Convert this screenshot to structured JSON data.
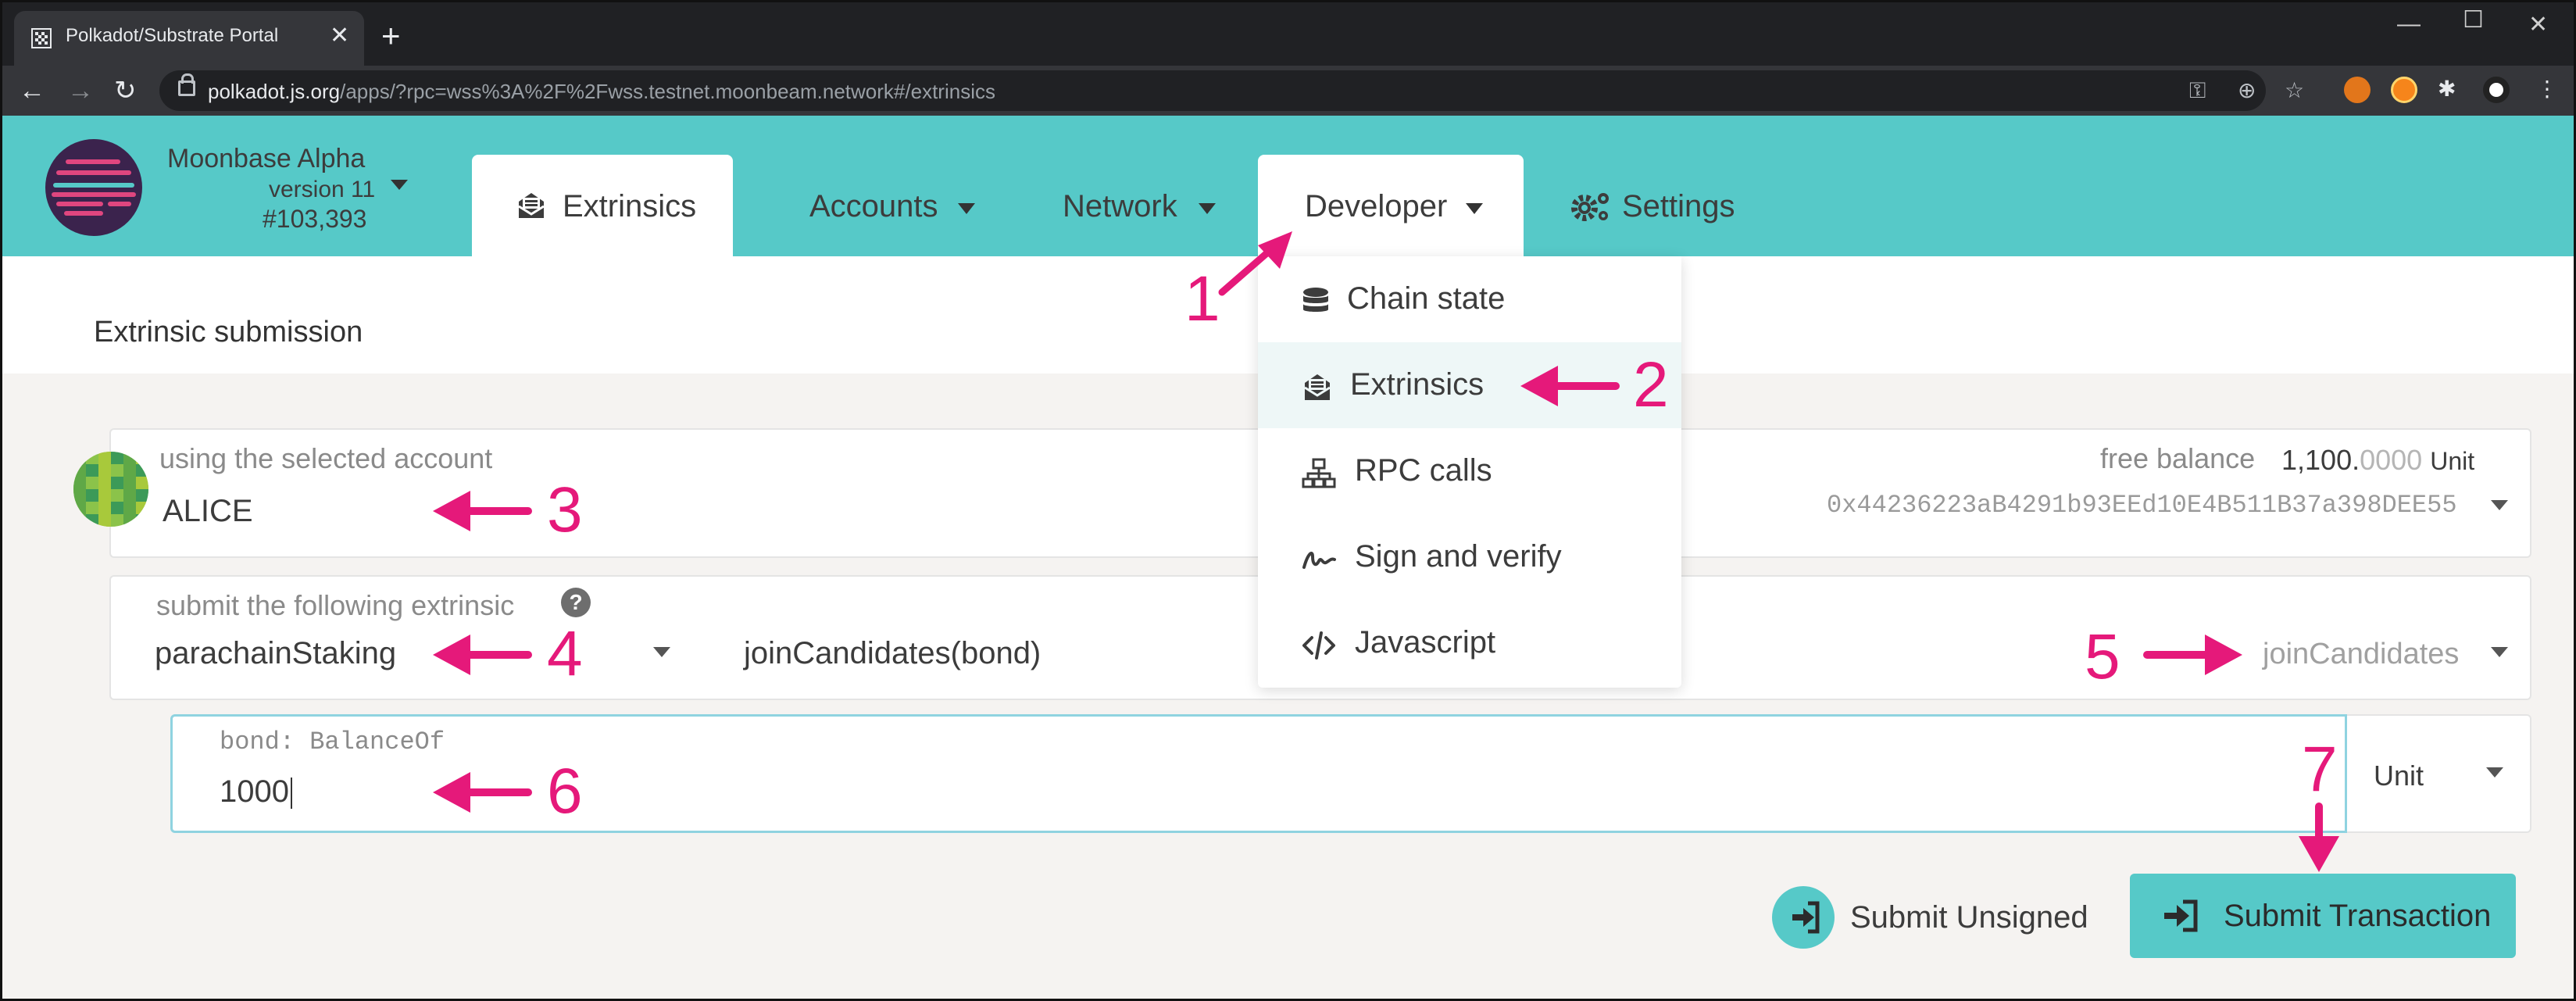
{
  "browser": {
    "tab_title": "Polkadot/Substrate Portal",
    "url_host": "polkadot.js.org",
    "url_rest": "/apps/?rpc=wss%3A%2F%2Fwss.testnet.moonbeam.network#/extrinsics"
  },
  "chain": {
    "name": "Moonbase Alpha",
    "version": "version 11",
    "block": "#103,393"
  },
  "nav": {
    "extrinsics": "Extrinsics",
    "accounts": "Accounts",
    "network": "Network",
    "developer": "Developer",
    "settings": "Settings"
  },
  "developer_menu": [
    {
      "label": "Chain state",
      "icon": "database-icon"
    },
    {
      "label": "Extrinsics",
      "icon": "envelope-open-icon"
    },
    {
      "label": "RPC calls",
      "icon": "network-icon"
    },
    {
      "label": "Sign and verify",
      "icon": "signature-icon"
    },
    {
      "label": "Javascript",
      "icon": "code-icon"
    }
  ],
  "subnav": {
    "tab": "Extrinsic submission"
  },
  "account": {
    "label": "using the selected account",
    "name": "ALICE",
    "balance_label": "free balance",
    "balance_int": "1,100.",
    "balance_frac": "0000",
    "balance_unit": "Unit",
    "address": "0x44236223aB4291b93EEd10E4B511B37a398DEE55"
  },
  "extrinsic": {
    "label": "submit the following extrinsic",
    "section": "parachainStaking",
    "method": "joinCandidates(bond)",
    "method_select": "joinCandidates"
  },
  "bond": {
    "label": "bond: BalanceOf",
    "value": "1000",
    "unit": "Unit"
  },
  "actions": {
    "unsigned": "Submit Unsigned",
    "submit": "Submit Transaction"
  },
  "annotations": [
    "1",
    "2",
    "3",
    "4",
    "5",
    "6",
    "7"
  ],
  "colors": {
    "accent": "#56c9c8",
    "annotation": "#e5197a",
    "background": "#f5f3f1"
  }
}
